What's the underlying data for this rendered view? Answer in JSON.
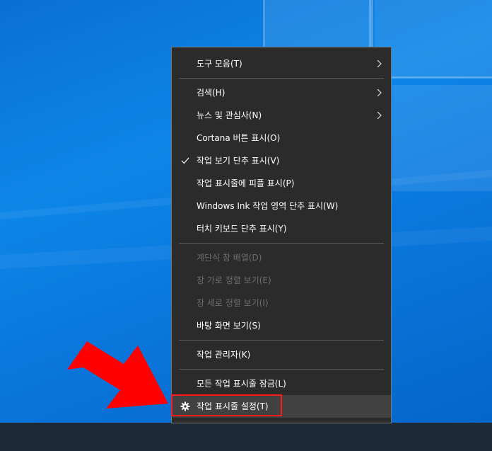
{
  "colors": {
    "menu_background": "#2b2b2b",
    "menu_text": "#ffffff",
    "disabled_text": "#6d6d6d",
    "annotation_red": "#ff1a1a",
    "desktop_blue": "#0a78de",
    "taskbar": "#1e2936"
  },
  "context_menu": {
    "items": [
      {
        "label": "도구 모음(T)",
        "submenu": true,
        "enabled": true
      },
      {
        "label": "검색(H)",
        "submenu": true,
        "enabled": true
      },
      {
        "label": "뉴스 및 관심사(N)",
        "submenu": true,
        "enabled": true
      },
      {
        "label": "Cortana 버튼 표시(O)",
        "enabled": true
      },
      {
        "label": "작업 보기 단추 표시(V)",
        "checked": true,
        "enabled": true
      },
      {
        "label": "작업 표시줄에 피플 표시(P)",
        "enabled": true
      },
      {
        "label": "Windows Ink 작업 영역 단추 표시(W)",
        "enabled": true
      },
      {
        "label": "터치 키보드 단추 표시(Y)",
        "enabled": true
      },
      {
        "label": "계단식 창 배열(D)",
        "enabled": false
      },
      {
        "label": "창 가로 정렬 보기(E)",
        "enabled": false
      },
      {
        "label": "창 세로 정렬 보기(I)",
        "enabled": false
      },
      {
        "label": "바탕 화면 보기(S)",
        "enabled": true
      },
      {
        "label": "작업 관리자(K)",
        "enabled": true
      },
      {
        "label": "모든 작업 표시줄 잠금(L)",
        "enabled": true
      },
      {
        "label": "작업 표시줄 설정(T)",
        "icon": "gear-icon",
        "enabled": true,
        "highlighted": true
      }
    ]
  },
  "annotation": {
    "arrow": "red-arrow-pointing-to-taskbar-settings"
  }
}
